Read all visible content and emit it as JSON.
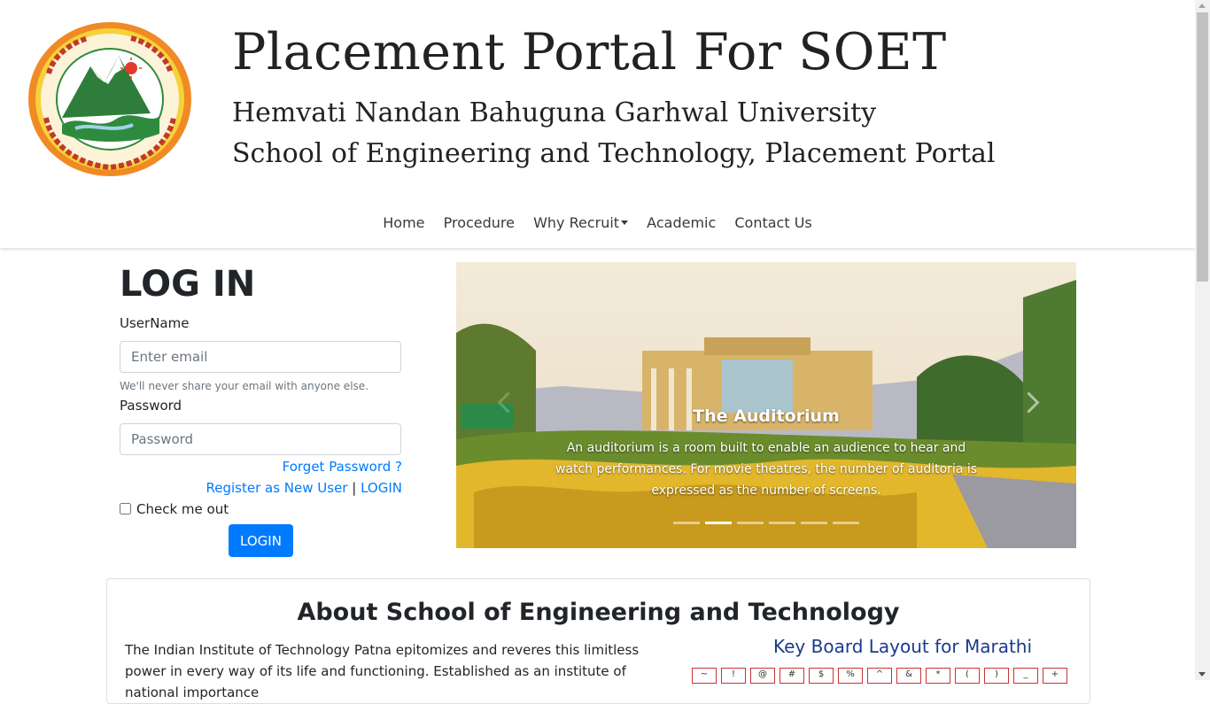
{
  "header": {
    "title": "Placement Portal For SOET",
    "subtitle1": "Hemvati Nandan Bahuguna Garhwal University",
    "subtitle2": "School of Engineering and Technology, Placement Portal"
  },
  "nav": {
    "items": [
      "Home",
      "Procedure",
      "Why Recruit",
      "Academic",
      "Contact Us"
    ]
  },
  "login": {
    "title": "LOG IN",
    "username_label": "UserName",
    "username_placeholder": "Enter email",
    "hint": "We'll never share your email with anyone else.",
    "password_label": "Password",
    "password_placeholder": "Password",
    "forget_password": "Forget Password ?",
    "register": "Register as New User",
    "separator": "|",
    "login_link": "LOGIN",
    "remember": "Check me out",
    "submit": "LOGIN"
  },
  "carousel": {
    "caption_title": "The Auditorium",
    "caption_text": "An auditorium is a room built to enable an audience to hear and watch performances. For movie theatres, the number of auditoria is expressed as the number of screens.",
    "slide_count": 6,
    "active_index": 1
  },
  "about": {
    "title": "About School of Engineering and Technology",
    "text": "The Indian Institute of Technology Patna epitomizes and reveres this limitless power in every way of its life and functioning. Established as an institute of national importance",
    "keyboard_title": "Key Board Layout for Marathi",
    "keyboard_keys": [
      "~",
      "!",
      "@",
      "#",
      "$",
      "%",
      "^",
      "&",
      "*",
      "(",
      ")",
      "_",
      "+"
    ]
  },
  "colors": {
    "primary": "#007bff",
    "nav_text": "#343a40",
    "logo_ring": "#e8832a",
    "logo_green": "#2e8b3d"
  }
}
